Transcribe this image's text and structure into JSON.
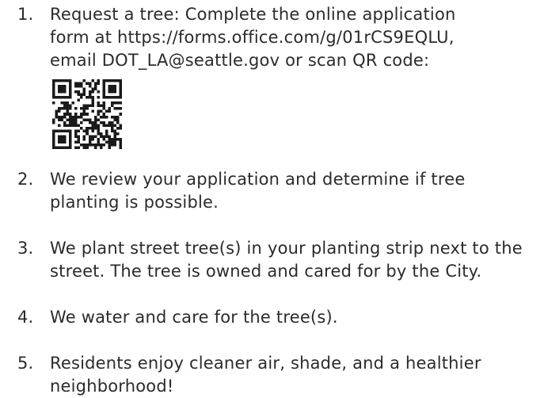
{
  "steps": [
    {
      "number": "1.",
      "text": "Request a tree: Complete the online application\nform at https://forms.office.com/g/01rCS9EQLU,\nemail DOT_LA@seattle.gov or scan QR code:"
    },
    {
      "number": "2.",
      "text": "We review your application and determine if tree\nplanting is possible."
    },
    {
      "number": "3.",
      "text": "We plant street tree(s) in your planting strip next to the\nstreet. The tree is owned and cared for by the City."
    },
    {
      "number": "4.",
      "text": "We water and care for the tree(s)."
    },
    {
      "number": "5.",
      "text": "Residents enjoy cleaner air, shade, and a healthier\nneighborhood!"
    }
  ],
  "qr_code": {
    "icon": "qr-code-icon",
    "color": "#1a1a1a"
  }
}
